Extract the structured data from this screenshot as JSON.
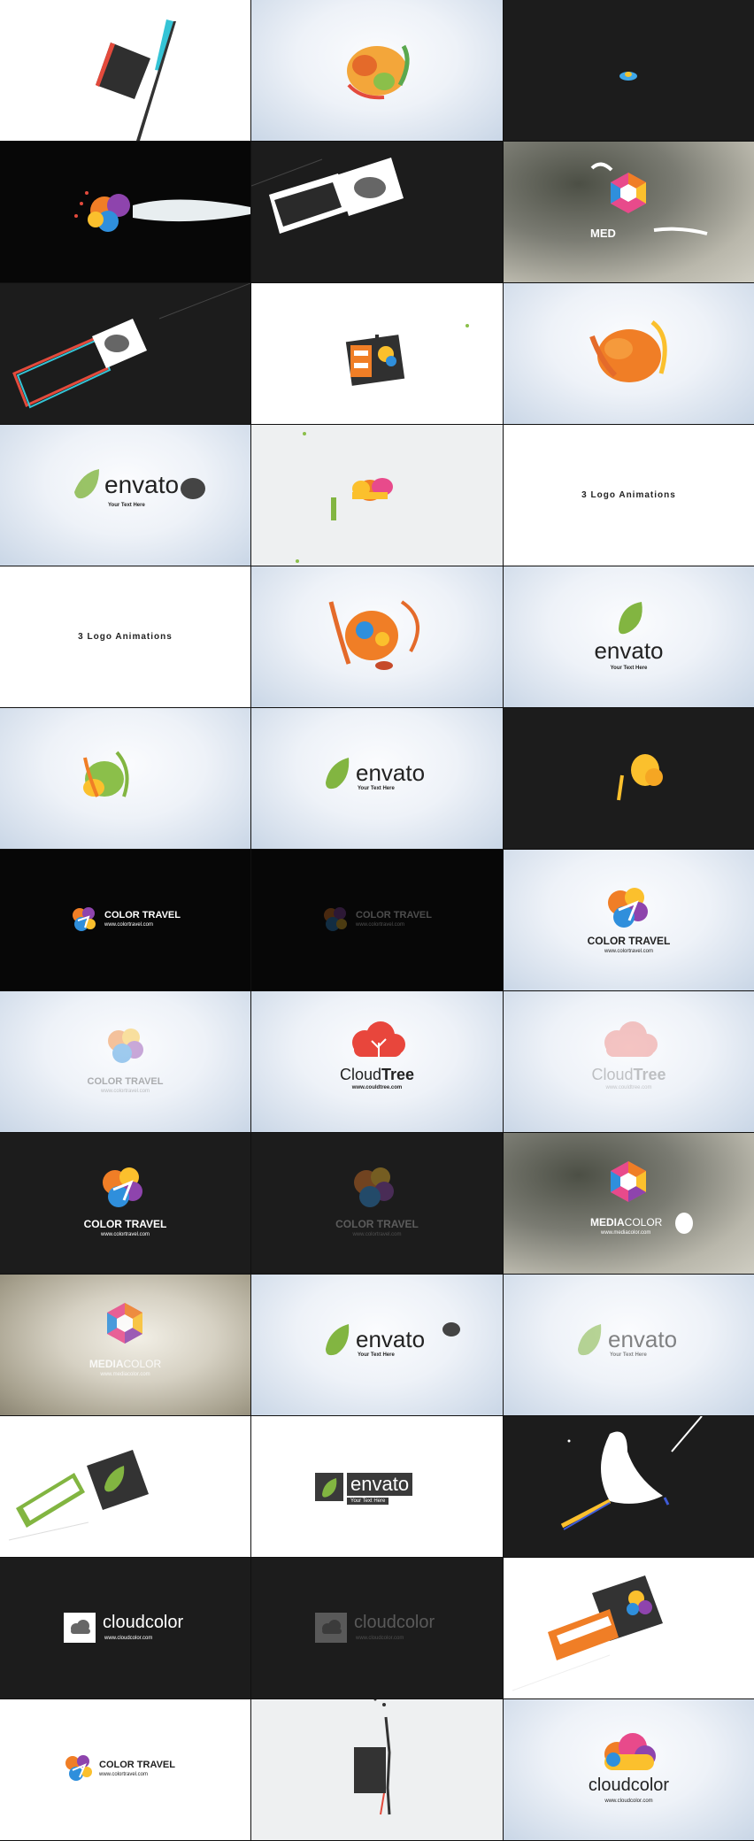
{
  "texts": {
    "envato": "envato",
    "your_text_here": "Your Text Here",
    "three_logo_animations": "3 Logo Animations",
    "color_travel": "COLOR TRAVEL",
    "colortravel_url": "www.colortravel.com",
    "cloudtree_cloud": "Cloud",
    "cloudtree_tree": "Tree",
    "cloudtree_url": "www.couldtree.com",
    "mediacolor_media": "MEDIA",
    "mediacolor_color": "COLOR",
    "mediacolor_partial": "MED",
    "mediacolor_url": "www.mediacolor.com",
    "cloudcolor": "cloudcolor",
    "cloudcolor_url": "www.cloudcolor.com"
  },
  "colors": {
    "envato_green": "#82b541",
    "cloud_red": "#e8463c",
    "orange": "#f07e26",
    "yellow": "#fbc02d",
    "blue": "#2f8fdc",
    "purple": "#8e44ad",
    "pink": "#e84a8b",
    "dark_card": "#3a3a3a"
  }
}
